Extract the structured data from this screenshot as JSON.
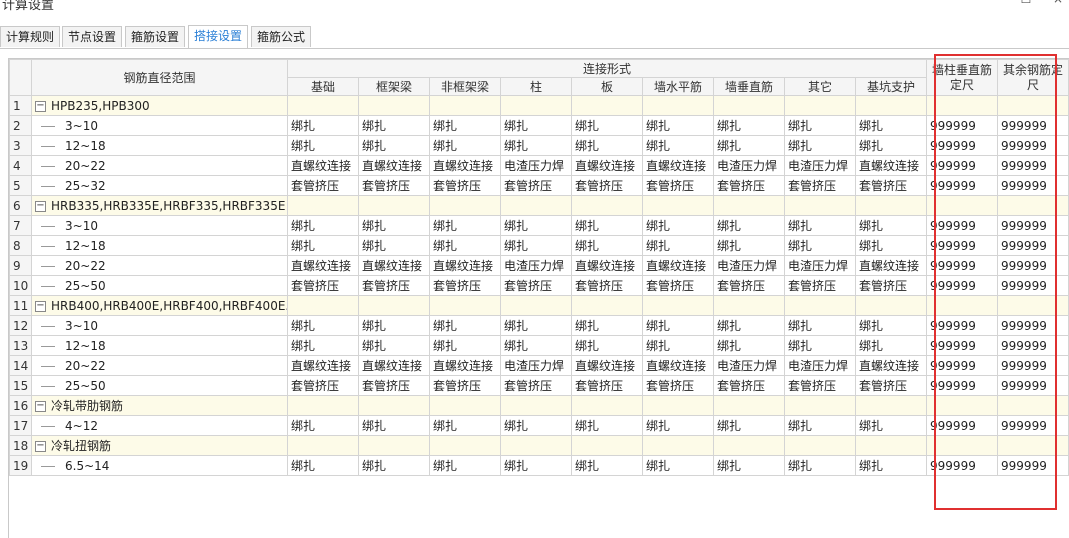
{
  "window": {
    "title": "计算设置",
    "controls": [
      "—",
      "☐",
      "×"
    ]
  },
  "tabs": [
    {
      "label": "计算规则",
      "active": false
    },
    {
      "label": "节点设置",
      "active": false
    },
    {
      "label": "箍筋设置",
      "active": false
    },
    {
      "label": "搭接设置",
      "active": true
    },
    {
      "label": "箍筋公式",
      "active": false
    }
  ],
  "header": {
    "range_col": "钢筋直径范围",
    "connection_group": "连接形式",
    "connection_cols": [
      "基础",
      "框架梁",
      "非框架梁",
      "柱",
      "板",
      "墙水平筋",
      "墙垂直筋",
      "其它",
      "基坑支护"
    ],
    "col_wall_column": "墙柱垂直筋定尺",
    "col_other_rebar": "其余钢筋定尺"
  },
  "rows": [
    {
      "n": "1",
      "group": true,
      "label": "HPB235,HPB300"
    },
    {
      "n": "2",
      "label": "3~10",
      "vals": [
        "绑扎",
        "绑扎",
        "绑扎",
        "绑扎",
        "绑扎",
        "绑扎",
        "绑扎",
        "绑扎",
        "绑扎"
      ],
      "d1": "999999",
      "d2": "999999"
    },
    {
      "n": "3",
      "label": "12~18",
      "vals": [
        "绑扎",
        "绑扎",
        "绑扎",
        "绑扎",
        "绑扎",
        "绑扎",
        "绑扎",
        "绑扎",
        "绑扎"
      ],
      "d1": "999999",
      "d2": "999999"
    },
    {
      "n": "4",
      "label": "20~22",
      "vals": [
        "直螺纹连接",
        "直螺纹连接",
        "直螺纹连接",
        "电渣压力焊",
        "直螺纹连接",
        "直螺纹连接",
        "电渣压力焊",
        "电渣压力焊",
        "直螺纹连接"
      ],
      "d1": "999999",
      "d2": "999999"
    },
    {
      "n": "5",
      "label": "25~32",
      "vals": [
        "套管挤压",
        "套管挤压",
        "套管挤压",
        "套管挤压",
        "套管挤压",
        "套管挤压",
        "套管挤压",
        "套管挤压",
        "套管挤压"
      ],
      "d1": "999999",
      "d2": "999999"
    },
    {
      "n": "6",
      "group": true,
      "label": "HRB335,HRB335E,HRBF335,HRBF335E"
    },
    {
      "n": "7",
      "label": "3~10",
      "vals": [
        "绑扎",
        "绑扎",
        "绑扎",
        "绑扎",
        "绑扎",
        "绑扎",
        "绑扎",
        "绑扎",
        "绑扎"
      ],
      "d1": "999999",
      "d2": "999999"
    },
    {
      "n": "8",
      "label": "12~18",
      "vals": [
        "绑扎",
        "绑扎",
        "绑扎",
        "绑扎",
        "绑扎",
        "绑扎",
        "绑扎",
        "绑扎",
        "绑扎"
      ],
      "d1": "999999",
      "d2": "999999"
    },
    {
      "n": "9",
      "label": "20~22",
      "vals": [
        "直螺纹连接",
        "直螺纹连接",
        "直螺纹连接",
        "电渣压力焊",
        "直螺纹连接",
        "直螺纹连接",
        "电渣压力焊",
        "电渣压力焊",
        "直螺纹连接"
      ],
      "d1": "999999",
      "d2": "999999"
    },
    {
      "n": "10",
      "label": "25~50",
      "vals": [
        "套管挤压",
        "套管挤压",
        "套管挤压",
        "套管挤压",
        "套管挤压",
        "套管挤压",
        "套管挤压",
        "套管挤压",
        "套管挤压"
      ],
      "d1": "999999",
      "d2": "999999"
    },
    {
      "n": "11",
      "group": true,
      "label": "HRB400,HRB400E,HRBF400,HRBF400E..."
    },
    {
      "n": "12",
      "label": "3~10",
      "vals": [
        "绑扎",
        "绑扎",
        "绑扎",
        "绑扎",
        "绑扎",
        "绑扎",
        "绑扎",
        "绑扎",
        "绑扎"
      ],
      "d1": "999999",
      "d2": "999999"
    },
    {
      "n": "13",
      "label": "12~18",
      "vals": [
        "绑扎",
        "绑扎",
        "绑扎",
        "绑扎",
        "绑扎",
        "绑扎",
        "绑扎",
        "绑扎",
        "绑扎"
      ],
      "d1": "999999",
      "d2": "999999"
    },
    {
      "n": "14",
      "label": "20~22",
      "vals": [
        "直螺纹连接",
        "直螺纹连接",
        "直螺纹连接",
        "电渣压力焊",
        "直螺纹连接",
        "直螺纹连接",
        "电渣压力焊",
        "电渣压力焊",
        "直螺纹连接"
      ],
      "d1": "999999",
      "d2": "999999"
    },
    {
      "n": "15",
      "label": "25~50",
      "vals": [
        "套管挤压",
        "套管挤压",
        "套管挤压",
        "套管挤压",
        "套管挤压",
        "套管挤压",
        "套管挤压",
        "套管挤压",
        "套管挤压"
      ],
      "d1": "999999",
      "d2": "999999"
    },
    {
      "n": "16",
      "group": true,
      "label": "冷轧带肋钢筋"
    },
    {
      "n": "17",
      "label": "4~12",
      "vals": [
        "绑扎",
        "绑扎",
        "绑扎",
        "绑扎",
        "绑扎",
        "绑扎",
        "绑扎",
        "绑扎",
        "绑扎"
      ],
      "d1": "999999",
      "d2": "999999"
    },
    {
      "n": "18",
      "group": true,
      "label": "冷轧扭钢筋"
    },
    {
      "n": "19",
      "label": "6.5~14",
      "vals": [
        "绑扎",
        "绑扎",
        "绑扎",
        "绑扎",
        "绑扎",
        "绑扎",
        "绑扎",
        "绑扎",
        "绑扎"
      ],
      "d1": "999999",
      "d2": "999999"
    }
  ],
  "toggle_symbol": "−",
  "accent_color": "#2a7fd6",
  "highlight_color": "#e03030"
}
